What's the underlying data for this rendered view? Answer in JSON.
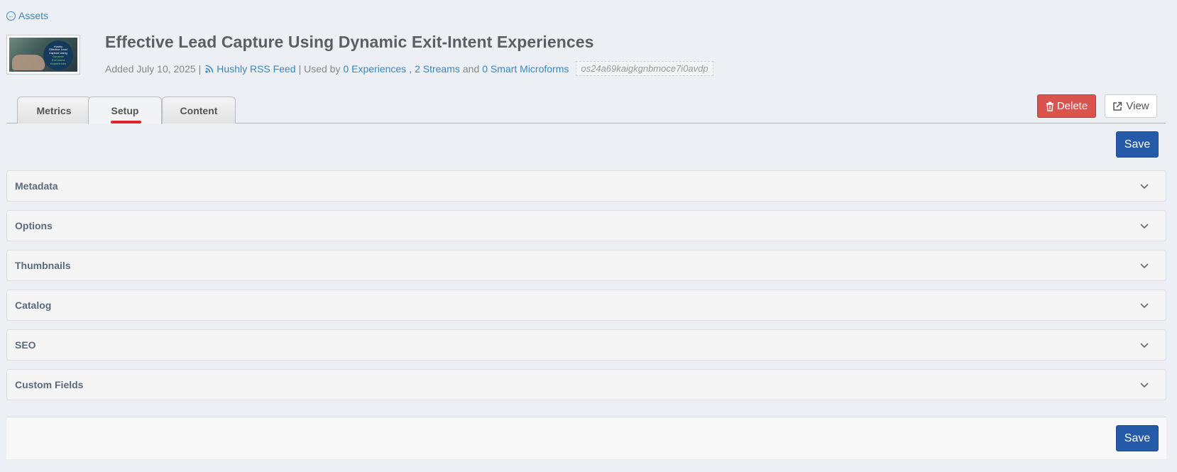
{
  "nav": {
    "back_label": "Assets"
  },
  "asset": {
    "thumbnail_text": [
      "Hushly",
      "Effective Lead",
      "Capture Using",
      "Dynamic",
      "Exit-Intent",
      "Experiences"
    ],
    "title": "Effective Lead Capture Using Dynamic Exit-Intent Experiences",
    "added": "Added July 10, 2025",
    "separator": "|",
    "source": "Hushly RSS Feed",
    "used_by_prefix": "| Used by",
    "experiences": "0 Experiences",
    "comma": ",",
    "streams": "2 Streams",
    "and_text": "and",
    "microforms": "0 Smart Microforms",
    "code": "os24a69kaigkgnbmoce7i0avdp"
  },
  "tabs": [
    {
      "label": "Metrics",
      "active": false
    },
    {
      "label": "Setup",
      "active": true
    },
    {
      "label": "Content",
      "active": false
    }
  ],
  "actions": {
    "delete_label": "Delete",
    "view_label": "View",
    "save_label": "Save"
  },
  "panels": [
    {
      "label": "Metadata"
    },
    {
      "label": "Options"
    },
    {
      "label": "Thumbnails"
    },
    {
      "label": "Catalog"
    },
    {
      "label": "SEO"
    },
    {
      "label": "Custom Fields"
    }
  ],
  "colors": {
    "link": "#3a87c0",
    "delete": "#d9534f",
    "save": "#245aa8",
    "active_tab_marker": "#e2242e"
  }
}
